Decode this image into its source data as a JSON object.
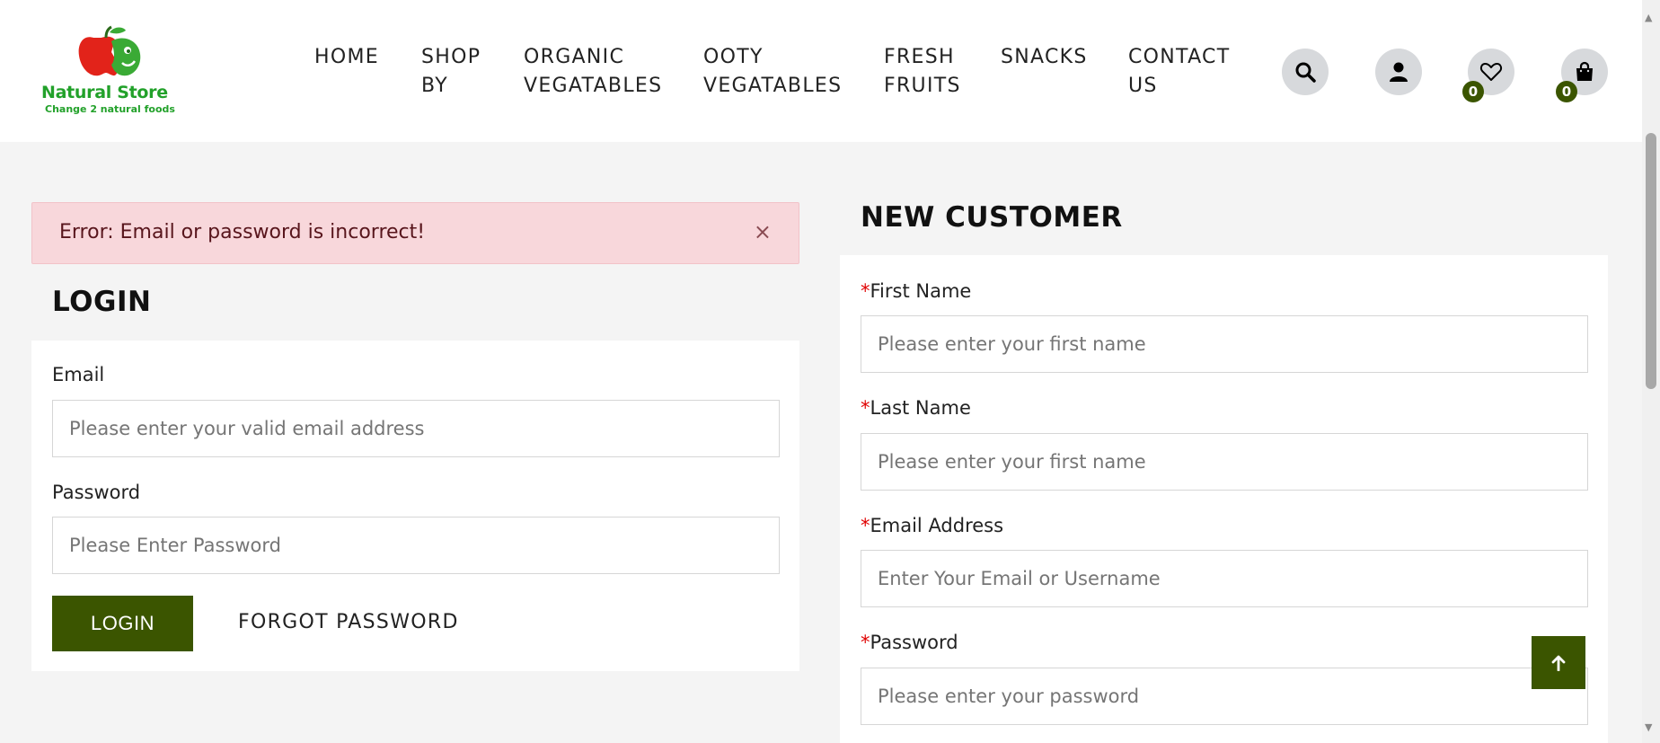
{
  "brand": {
    "name": "Natural Store",
    "tagline": "Change 2 natural foods"
  },
  "nav": [
    {
      "label": "HOME"
    },
    {
      "label": "SHOP\nBY"
    },
    {
      "label": "ORGANIC\nVEGATABLES"
    },
    {
      "label": "OOTY\nVEGATABLES"
    },
    {
      "label": "FRESH\nFRUITS"
    },
    {
      "label": "SNACKS"
    },
    {
      "label": "CONTACT\nUS"
    }
  ],
  "header_icons": {
    "search": "search-icon",
    "account": "user-icon",
    "wishlist": "heart-icon",
    "wishlist_count": "0",
    "cart": "shopping-bag-icon",
    "cart_count": "0"
  },
  "alert": {
    "message": "Error: Email or password is incorrect!",
    "close": "×"
  },
  "login": {
    "title": "LOGIN",
    "email_label": "Email",
    "email_placeholder": "Please enter your valid email address",
    "password_label": "Password",
    "password_placeholder": "Please Enter Password",
    "submit_label": "LOGIN",
    "forgot_label": "FORGOT PASSWORD"
  },
  "register": {
    "title": "NEW CUSTOMER",
    "required_mark": "*",
    "first_name_label": "First Name",
    "first_name_placeholder": "Please enter your first name",
    "last_name_label": "Last Name",
    "last_name_placeholder": "Please enter your first name",
    "email_label": "Email Address",
    "email_placeholder": "Enter Your Email or Username",
    "password_label": "Password",
    "password_placeholder": "Please enter your password"
  },
  "colors": {
    "accent": "#3b5500",
    "brand_green": "#22a12a",
    "alert_bg": "#f8d7db",
    "required": "#e00000"
  }
}
